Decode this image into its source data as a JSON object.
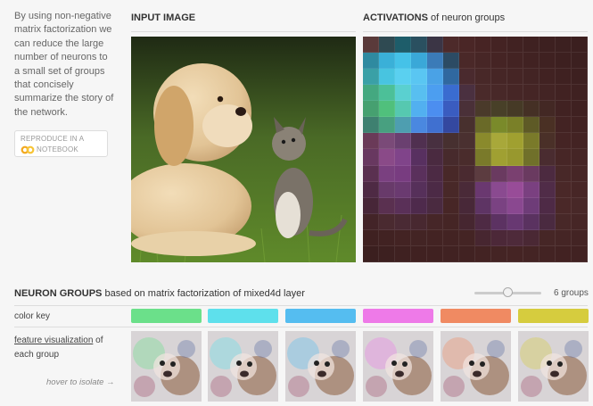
{
  "intro": {
    "lines": [
      "By using non-negative",
      "matrix factorization we",
      "can reduce the large",
      "number of neurons to",
      "a small set of groups",
      "that concisely",
      "summarize the story of",
      "the network."
    ]
  },
  "reproduce": {
    "line1": "REPRODUCE IN A",
    "line2": "NOTEBOOK",
    "icon": "colab-icon"
  },
  "input_section": {
    "title": "INPUT IMAGE"
  },
  "activations_section": {
    "title_bold": "ACTIVATIONS",
    "title_rest": " of neuron groups"
  },
  "groups_section": {
    "title_bold": "NEURON GROUPS",
    "title_rest": " based on matrix factorization of mixed4d layer",
    "count_label": "6 groups",
    "slider_value": 6
  },
  "rows": {
    "color_key": "color key",
    "feature_link": "feature visualization",
    "feature_of": " of",
    "each_group": "each group",
    "hover_hint": "hover to isolate →"
  },
  "groups": [
    {
      "color": "#6be08a"
    },
    {
      "color": "#5ee0ec"
    },
    {
      "color": "#55bdf0"
    },
    {
      "color": "#ee7ae8"
    },
    {
      "color": "#f08a62"
    },
    {
      "color": "#d6cc3e"
    }
  ],
  "activation_grid": [
    [
      "#5a3a3a",
      "#2f4a52",
      "#1e5d6a",
      "#2a5060",
      "#3b3545",
      "#4d2a2a",
      "#4a2626",
      "#472424",
      "#442323",
      "#412222",
      "#3f2121",
      "#3d2020",
      "#3c2020",
      "#3b1f1f"
    ],
    [
      "#2f8aa0",
      "#3ab0d8",
      "#45c2e8",
      "#3aa8d8",
      "#3b7bb8",
      "#2c4b64",
      "#4a2828",
      "#472626",
      "#452424",
      "#432323",
      "#412222",
      "#3f2121",
      "#3d2020",
      "#3c2020"
    ],
    [
      "#3aa0a6",
      "#48c4e0",
      "#5ad0f0",
      "#5ac6f2",
      "#4aa2e6",
      "#3068a0",
      "#4a2a2e",
      "#482828",
      "#462626",
      "#452525",
      "#432424",
      "#412222",
      "#3f2121",
      "#3d2020"
    ],
    [
      "#44a880",
      "#4cc098",
      "#5ad0d0",
      "#58bff0",
      "#4c9ef0",
      "#3a6cd0",
      "#4a3040",
      "#4a2a2a",
      "#482828",
      "#462626",
      "#452525",
      "#432424",
      "#412222",
      "#3f2121"
    ],
    [
      "#46a070",
      "#50c07c",
      "#56c8b0",
      "#52b0f0",
      "#4c8ef0",
      "#3a5cc0",
      "#4a3038",
      "#4a3a2a",
      "#484028",
      "#463a26",
      "#453025",
      "#432824",
      "#412222",
      "#3f2121"
    ],
    [
      "#3e8070",
      "#48a080",
      "#4e9eb0",
      "#4a88e0",
      "#4070d0",
      "#3448a0",
      "#48302e",
      "#6a6a28",
      "#7a8a2a",
      "#7a8028",
      "#5e5a26",
      "#4a3024",
      "#432323",
      "#412222"
    ],
    [
      "#6a3a58",
      "#7a4a78",
      "#6a4070",
      "#503050",
      "#483040",
      "#473030",
      "#4a3030",
      "#8a8a2c",
      "#a8a83a",
      "#a0a030",
      "#7a7a2a",
      "#4a3028",
      "#452424",
      "#432323"
    ],
    [
      "#683860",
      "#8a4a88",
      "#80448a",
      "#583060",
      "#4a2a40",
      "#472a2c",
      "#4a2c2c",
      "#7a7a2a",
      "#a0a032",
      "#98982e",
      "#70702a",
      "#4a2c30",
      "#472626",
      "#452525"
    ],
    [
      "#5a3050",
      "#7a4080",
      "#783c80",
      "#5a305c",
      "#4c2a44",
      "#482828",
      "#4a2a30",
      "#5c3c40",
      "#6a3a60",
      "#7a4070",
      "#6a3a60",
      "#4c2a40",
      "#482828",
      "#462626"
    ],
    [
      "#4e2a44",
      "#683a6a",
      "#6a3a70",
      "#56305a",
      "#4c2a46",
      "#482828",
      "#4a2a38",
      "#6a3870",
      "#8a4a90",
      "#984c98",
      "#7a4080",
      "#502c48",
      "#4a2828",
      "#472626"
    ],
    [
      "#472638",
      "#5a3050",
      "#5a3058",
      "#4e2a4c",
      "#4a2a40",
      "#472626",
      "#482838",
      "#5e3464",
      "#7a4282",
      "#8a4890",
      "#6e3c78",
      "#4e2a46",
      "#4a2828",
      "#482828"
    ],
    [
      "#432428",
      "#4a2a30",
      "#4a2a34",
      "#482830",
      "#462628",
      "#452525",
      "#462630",
      "#4e2a44",
      "#5c3262",
      "#683872",
      "#5a3260",
      "#4a2a40",
      "#482828",
      "#462626"
    ],
    [
      "#3f2121",
      "#412222",
      "#432323",
      "#432424",
      "#432323",
      "#432323",
      "#442424",
      "#472630",
      "#4c2838",
      "#4e2a3a",
      "#4a2834",
      "#462626",
      "#452525",
      "#432424"
    ],
    [
      "#3b1f1f",
      "#3d2020",
      "#3f2121",
      "#402121",
      "#402121",
      "#412222",
      "#412222",
      "#432323",
      "#442424",
      "#452424",
      "#442424",
      "#432323",
      "#422222",
      "#412222"
    ]
  ]
}
